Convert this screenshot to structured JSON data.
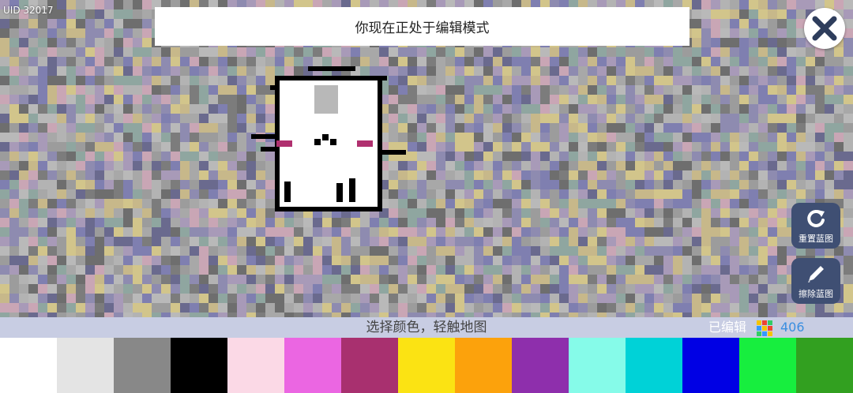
{
  "uid_label": "UID 32017",
  "banner": {
    "text": "你现在正处于编辑模式"
  },
  "buttons": {
    "close_icon": "close-x-icon",
    "reset": {
      "label": "重置蓝图",
      "icon": "refresh-icon"
    },
    "erase": {
      "label": "擦除蓝图",
      "icon": "pencil-icon"
    }
  },
  "status": {
    "hint": "选择颜色，轻触地图",
    "edited_label": "已编辑",
    "edited_count": "406"
  },
  "palette": [
    "#ffffff",
    "#e4e4e4",
    "#888888",
    "#000000",
    "#fbd9e6",
    "#eb66e2",
    "#a8306f",
    "#fbe313",
    "#fca20c",
    "#8e2fac",
    "#86fbe9",
    "#00d2d7",
    "#0000e4",
    "#17ee3e",
    "#32a020"
  ]
}
